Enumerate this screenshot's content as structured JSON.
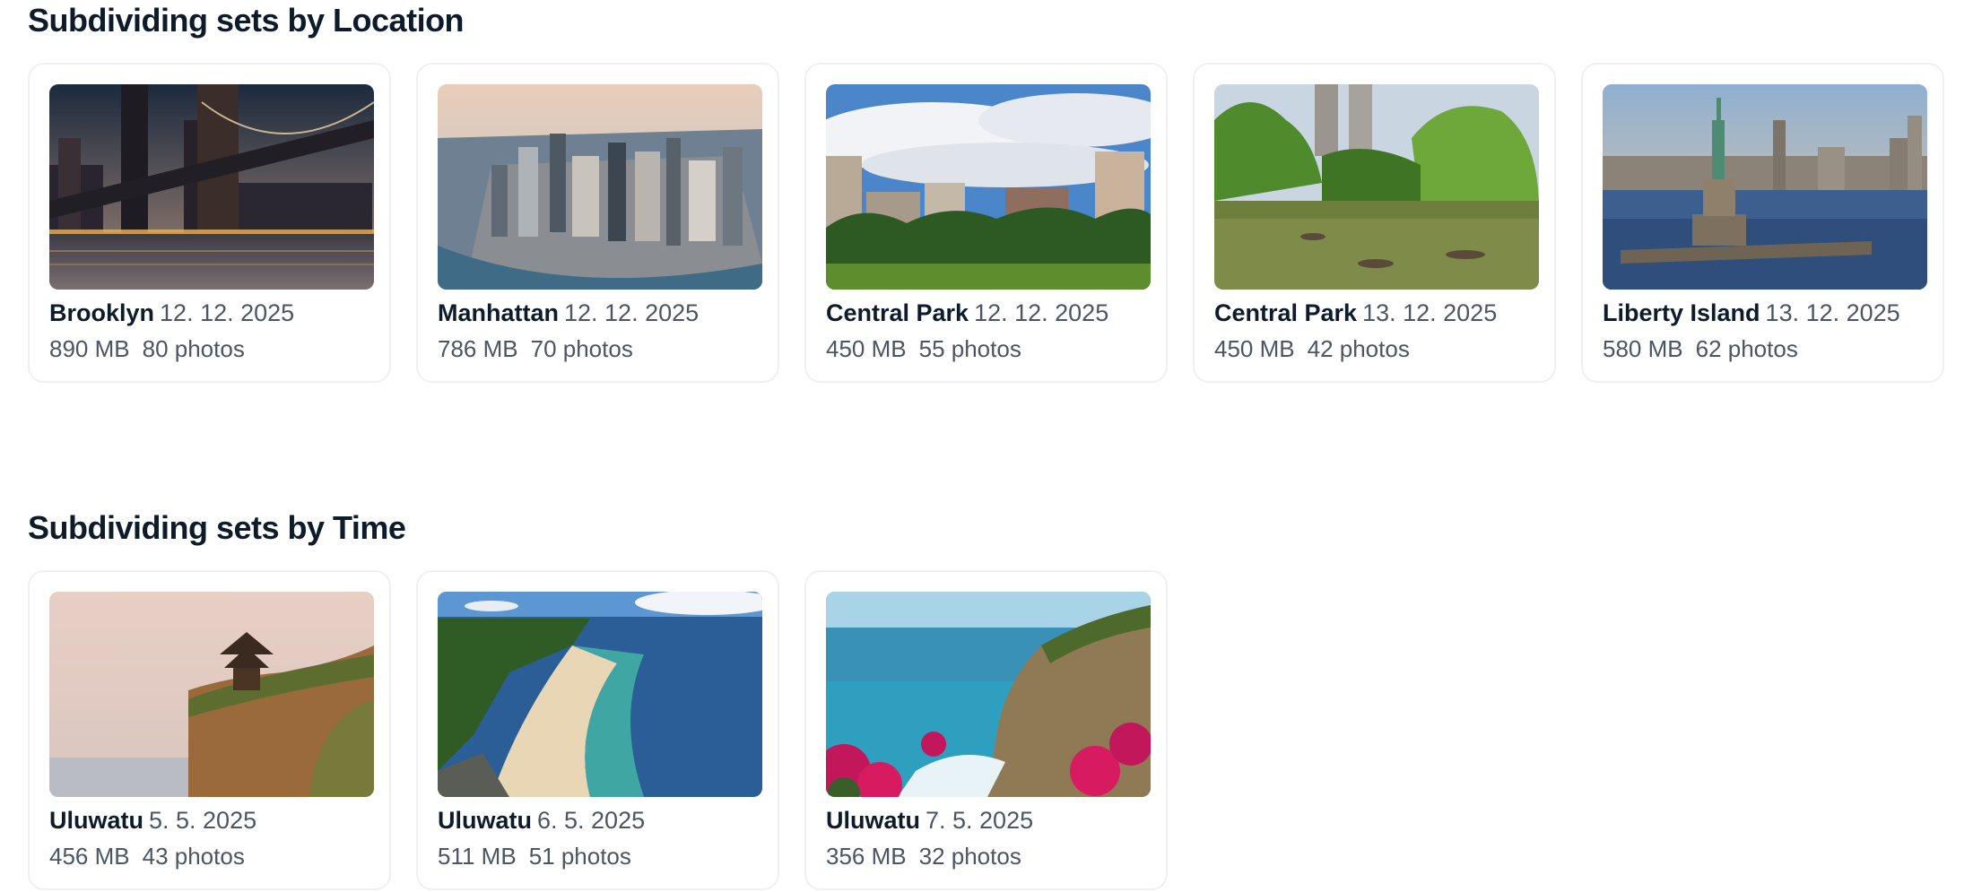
{
  "sections": [
    {
      "title": "Subdividing sets by Location",
      "cards": [
        {
          "name": "Brooklyn",
          "date": "12. 12. 2025",
          "size": "890 MB",
          "photos": "80 photos",
          "image": "brooklyn-bridge-night-photo"
        },
        {
          "name": "Manhattan",
          "date": "12. 12. 2025",
          "size": "786 MB",
          "photos": "70 photos",
          "image": "manhattan-skyline-aerial-photo"
        },
        {
          "name": "Central Park",
          "date": "12. 12. 2025",
          "size": "450 MB",
          "photos": "55 photos",
          "image": "central-park-meadow-photo"
        },
        {
          "name": "Central Park",
          "date": "13. 12. 2025",
          "size": "450 MB",
          "photos": "42 photos",
          "image": "central-park-lake-boats-photo"
        },
        {
          "name": "Liberty Island",
          "date": "13. 12. 2025",
          "size": "580 MB",
          "photos": "62 photos",
          "image": "statue-of-liberty-photo"
        }
      ]
    },
    {
      "title": "Subdividing sets by Time",
      "cards": [
        {
          "name": "Uluwatu",
          "date": "5. 5. 2025",
          "size": "456 MB",
          "photos": "43 photos",
          "image": "uluwatu-temple-cliff-photo"
        },
        {
          "name": "Uluwatu",
          "date": "6. 5. 2025",
          "size": "511 MB",
          "photos": "51 photos",
          "image": "uluwatu-beach-aerial-photo"
        },
        {
          "name": "Uluwatu",
          "date": "7. 5. 2025",
          "size": "356 MB",
          "photos": "32 photos",
          "image": "uluwatu-cliff-flowers-photo"
        }
      ]
    }
  ]
}
